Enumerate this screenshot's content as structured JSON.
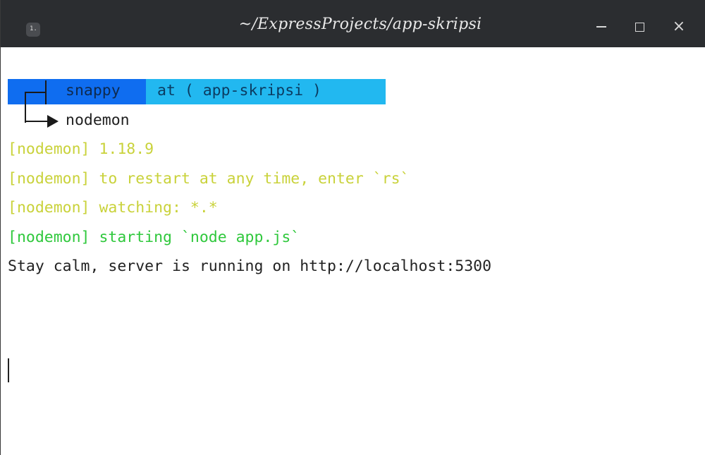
{
  "window": {
    "title": "~/ExpressProjects/app-skripsi",
    "app_icon_glyph": "1."
  },
  "controls": {
    "minimize": "minimize-icon",
    "maximize": "maximize-icon",
    "close": "×"
  },
  "prompt": {
    "user": "snappy",
    "location": "at (  app-skripsi )",
    "user_color": "#0f6df0",
    "location_color": "#22b8f0"
  },
  "command": "nodemon",
  "output": [
    {
      "text": "[nodemon] 1.18.9",
      "color": "yellow"
    },
    {
      "text": "[nodemon] to restart at any time, enter `rs`",
      "color": "yellow"
    },
    {
      "text": "[nodemon] watching: *.*",
      "color": "yellow"
    },
    {
      "text": "[nodemon] starting `node app.js`",
      "color": "green"
    },
    {
      "text": "Stay calm, server is running on http://localhost:5300",
      "color": "normal"
    }
  ]
}
